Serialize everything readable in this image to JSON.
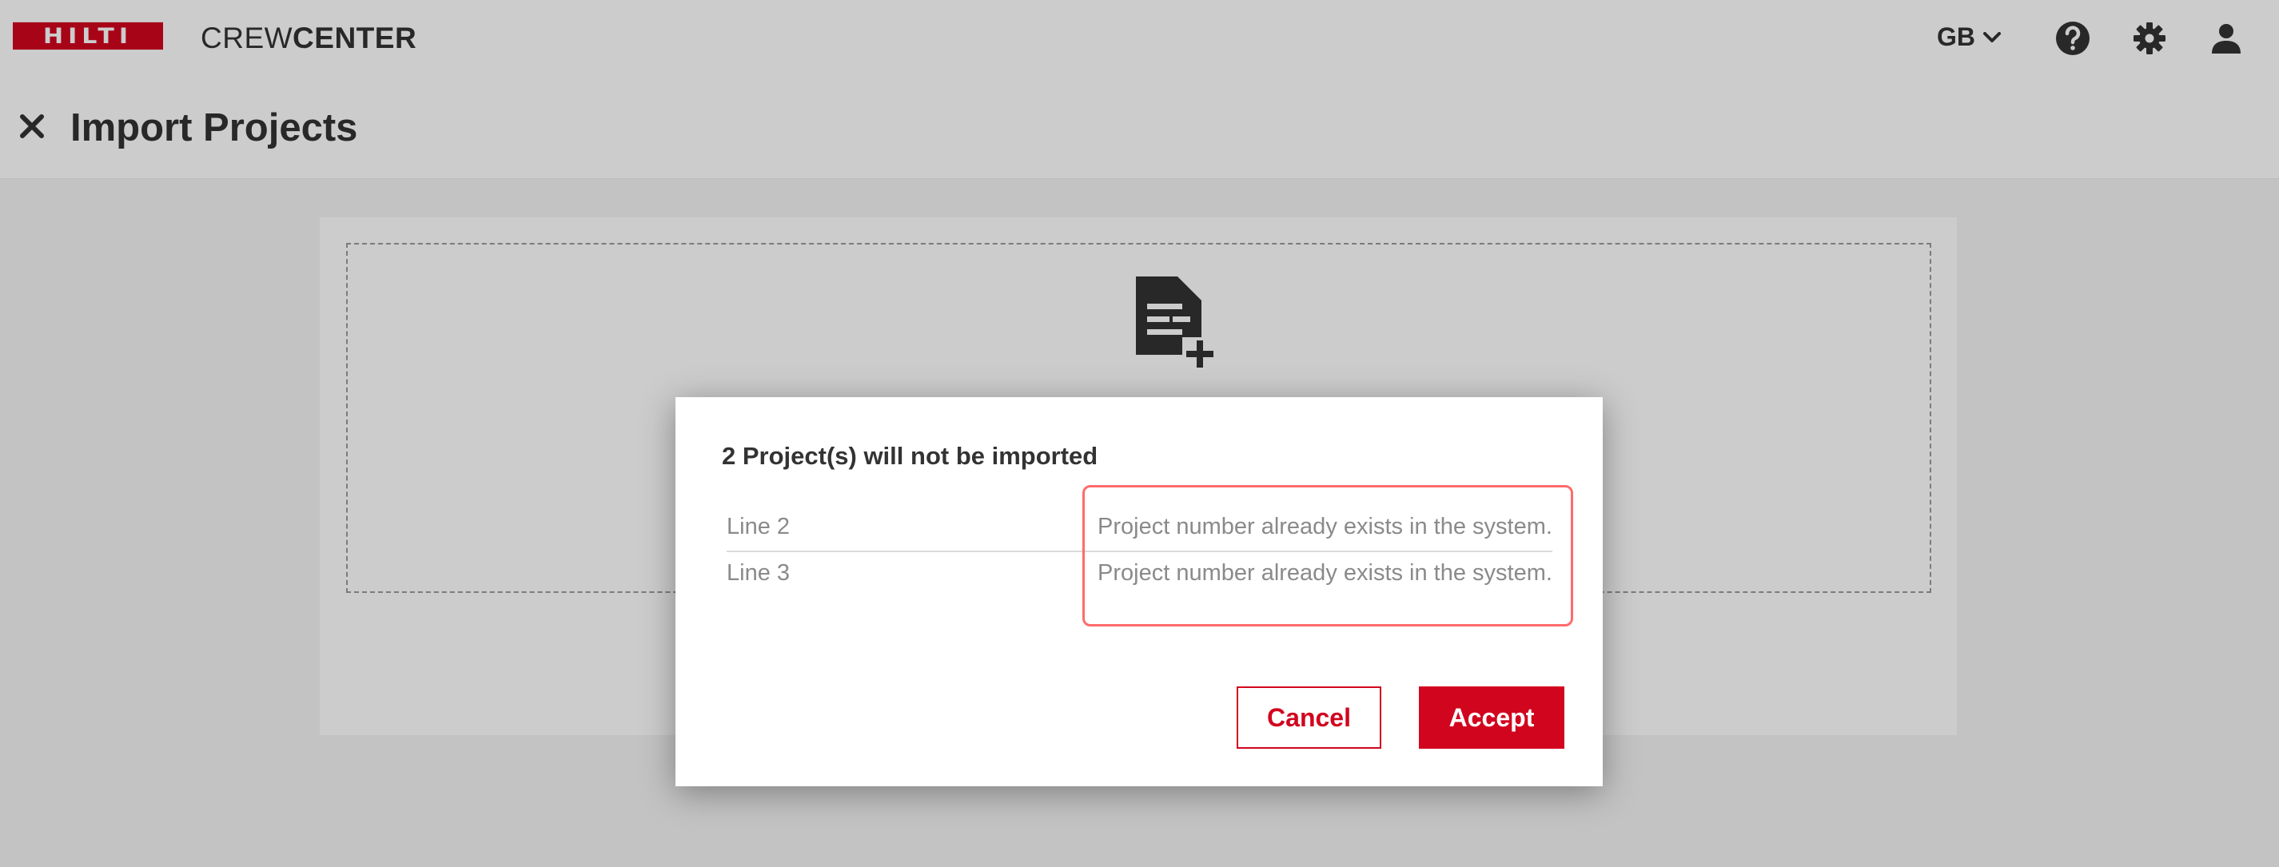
{
  "header": {
    "logo_text": "HILTI",
    "app_name_light": "CREW",
    "app_name_bold": "CENTER",
    "language": "GB",
    "icons": [
      "chevron-down-icon",
      "help-icon",
      "gear-icon",
      "user-icon"
    ]
  },
  "title_bar": {
    "close_icon": "close-icon",
    "title": "Import Projects"
  },
  "dropzone": {
    "icon": "file-add-icon"
  },
  "dialog": {
    "title": "2 Project(s) will not be imported",
    "rows": [
      {
        "line": "Line 2",
        "message": "Project number already exists in the system."
      },
      {
        "line": "Line 3",
        "message": "Project number already exists in the system."
      }
    ],
    "cancel_label": "Cancel",
    "accept_label": "Accept"
  },
  "colors": {
    "brand_red": "#d2051e",
    "highlight": "#ff6b6b",
    "text_dark": "#333333",
    "text_muted": "#8a8a8a"
  }
}
